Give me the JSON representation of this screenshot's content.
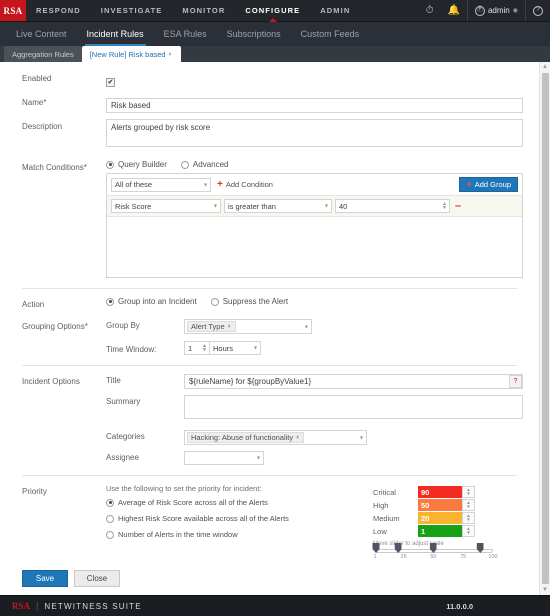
{
  "topnav": {
    "logo": "RSA",
    "items": [
      {
        "label": "RESPOND",
        "active": false
      },
      {
        "label": "INVESTIGATE",
        "active": false
      },
      {
        "label": "MONITOR",
        "active": false
      },
      {
        "label": "CONFIGURE",
        "active": true
      },
      {
        "label": "ADMIN",
        "active": false
      }
    ],
    "timer_icon": "stopwatch-icon",
    "bell_icon": "notifications-icon",
    "user_label": "admin",
    "help_icon": "help-icon"
  },
  "subnav": {
    "items": [
      {
        "label": "Live Content",
        "active": false
      },
      {
        "label": "Incident Rules",
        "active": true
      },
      {
        "label": "ESA Rules",
        "active": false
      },
      {
        "label": "Subscriptions",
        "active": false
      },
      {
        "label": "Custom Feeds",
        "active": false
      }
    ]
  },
  "tabs": [
    {
      "label": "Aggregation Rules",
      "active": false,
      "closable": false
    },
    {
      "label": "[New Rule] Risk based",
      "active": true,
      "closable": true
    }
  ],
  "form": {
    "enabled": {
      "label": "Enabled",
      "checked": true,
      "check_glyph": "✔"
    },
    "name": {
      "label": "Name*",
      "value": "Risk based"
    },
    "description": {
      "label": "Description",
      "value": "Alerts grouped by risk score"
    },
    "match_conditions": {
      "label": "Match Conditions*",
      "mode_options": [
        {
          "label": "Query Builder",
          "selected": true
        },
        {
          "label": "Advanced",
          "selected": false
        }
      ],
      "group_operator": "All of these",
      "add_condition_label": "Add Condition",
      "add_group_label": "Add Group",
      "conditions": [
        {
          "field": "Risk Score",
          "operator": "is greater than",
          "value": "40"
        }
      ]
    },
    "action": {
      "label": "Action",
      "options": [
        {
          "label": "Group into an Incident",
          "selected": true
        },
        {
          "label": "Suppress the Alert",
          "selected": false
        }
      ]
    },
    "grouping_options": {
      "label": "Grouping Options*",
      "group_by_label": "Group By",
      "group_by_tokens": [
        "Alert Type"
      ],
      "time_window_label": "Time Window:",
      "time_window_value": "1",
      "time_window_unit": "Hours"
    },
    "incident_options": {
      "label": "Incident Options",
      "title_label": "Title",
      "title_value": "${ruleName} for ${groupByValue1}",
      "title_info_icon": "info-icon",
      "summary_label": "Summary",
      "summary_value": "",
      "categories_label": "Categories",
      "categories_tokens": [
        "Hacking: Abuse of functionality"
      ],
      "assignee_label": "Assignee",
      "assignee_value": ""
    },
    "priority": {
      "label": "Priority",
      "hint": "Use the following to set the priority for incident:",
      "options": [
        {
          "label": "Average of Risk Score across all of the Alerts",
          "selected": true
        },
        {
          "label": "Highest Risk Score available across all of the Alerts",
          "selected": false
        },
        {
          "label": "Number of Alerts in the time window",
          "selected": false
        }
      ],
      "levels": [
        {
          "name": "Critical",
          "value": "90",
          "color": "#f42b21"
        },
        {
          "name": "High",
          "value": "50",
          "color": "#f97b3d"
        },
        {
          "name": "Medium",
          "value": "20",
          "color": "#fcb330"
        },
        {
          "name": "Low",
          "value": "1",
          "color": "#17a114"
        }
      ],
      "slider_hint": "Move slider to adjust scale",
      "slider_handles": [
        1,
        20,
        50,
        90
      ],
      "slider_ticks": [
        "1",
        "25",
        "50",
        "75",
        "100"
      ],
      "slider_min": 1,
      "slider_max": 100
    }
  },
  "buttons": {
    "save": "Save",
    "close": "Close"
  },
  "statusbar": {
    "brand": "RSA",
    "suite": "NETWITNESS SUITE",
    "version": "11.0.0.0"
  }
}
